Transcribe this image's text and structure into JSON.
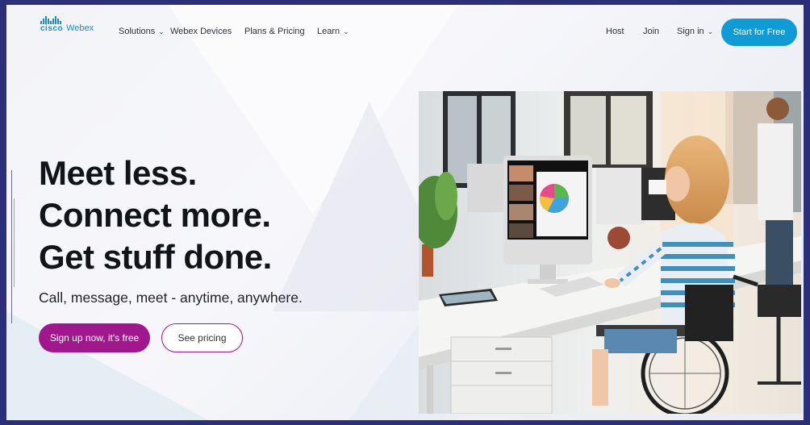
{
  "brand": {
    "company": "cisco",
    "product": "Webex",
    "color": "#1d8ad0"
  },
  "nav": {
    "items": [
      {
        "label": "Solutions",
        "has_dropdown": true
      },
      {
        "label": "Webex Devices",
        "has_dropdown": false
      },
      {
        "label": "Plans & Pricing",
        "has_dropdown": false
      },
      {
        "label": "Learn",
        "has_dropdown": true
      }
    ],
    "right_items": [
      {
        "label": "Host",
        "has_dropdown": false
      },
      {
        "label": "Join",
        "has_dropdown": false
      },
      {
        "label": "Sign in",
        "has_dropdown": true
      }
    ],
    "cta_label": "Start for Free",
    "chevron_glyph": "⌄"
  },
  "hero": {
    "title_lines": [
      "Meet less.",
      "Connect more.",
      "Get stuff done."
    ],
    "subtitle": "Call, message, meet - anytime, anywhere.",
    "primary_button": "Sign up now, it's free",
    "secondary_button": "See pricing"
  },
  "colors": {
    "accent_blue": "#0e9bd6",
    "accent_magenta": "#a1178d",
    "frame_border": "#2b2f7a"
  }
}
